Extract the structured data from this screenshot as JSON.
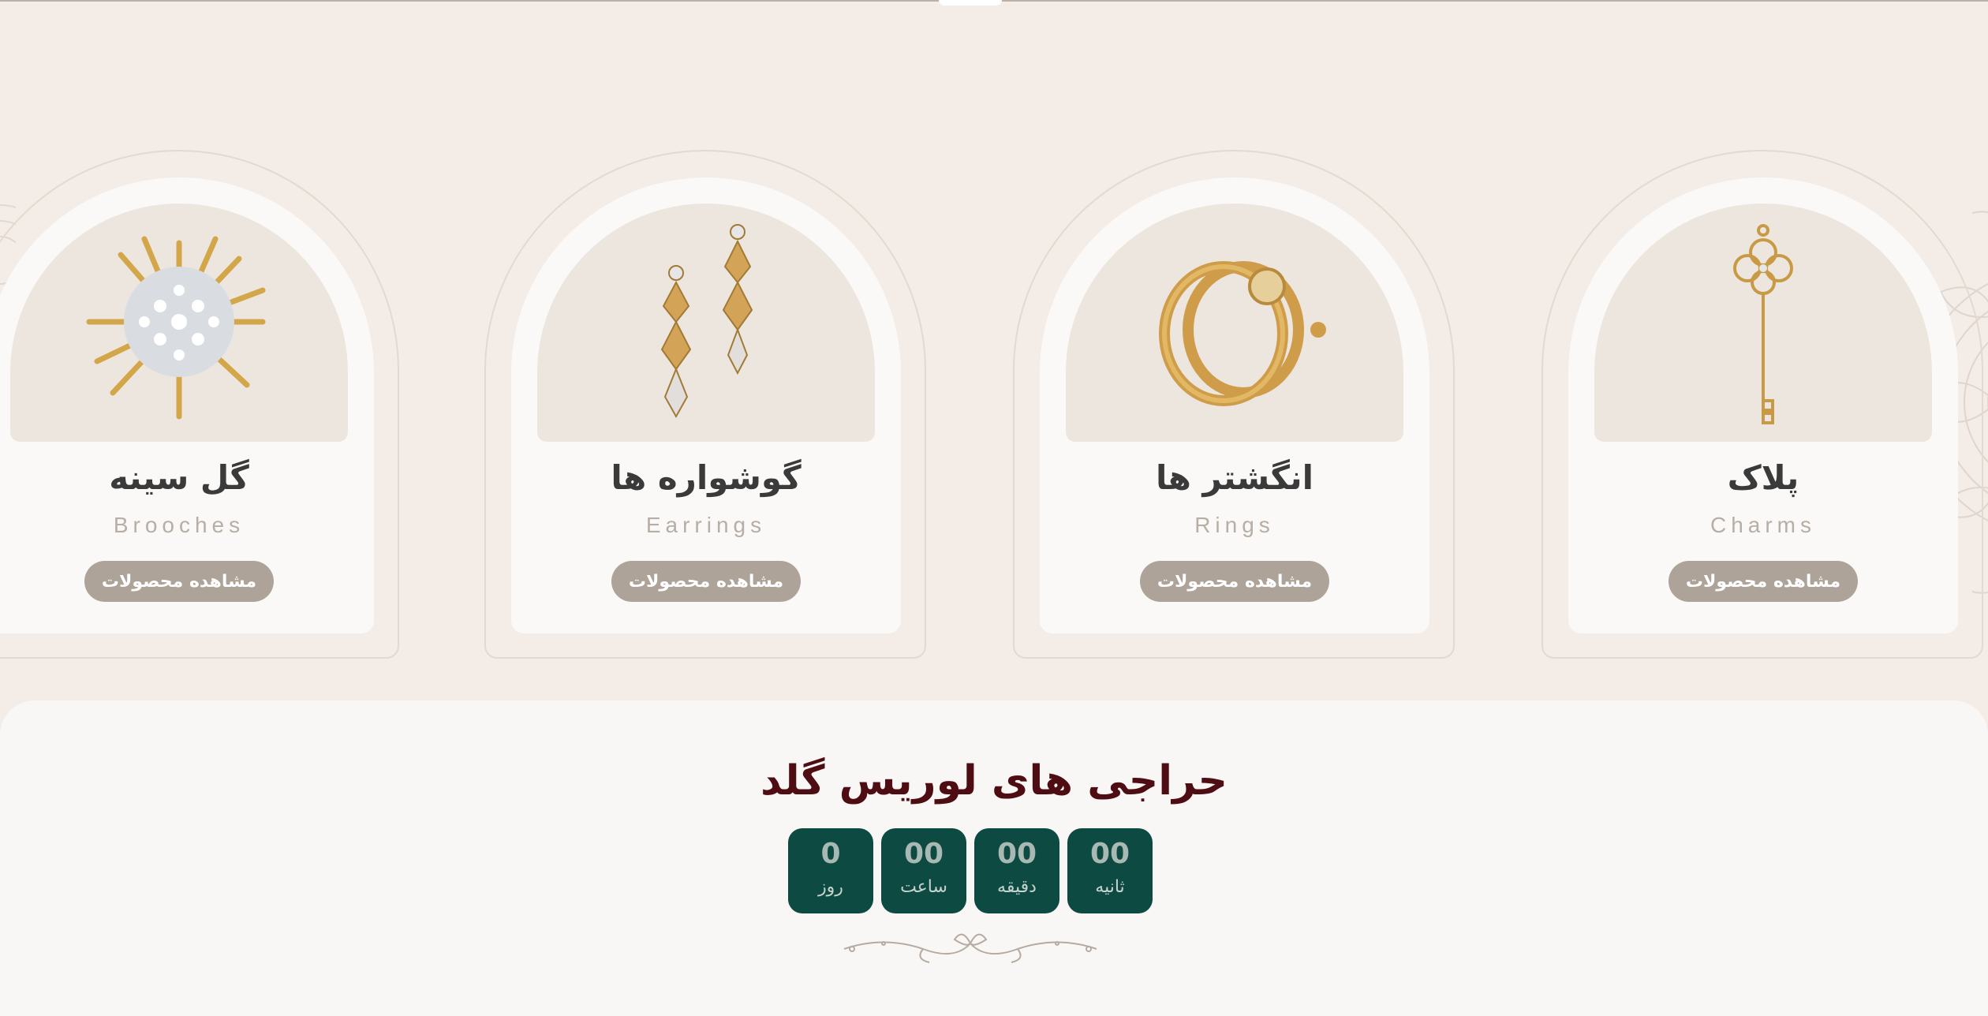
{
  "categories": [
    {
      "title": "گل سینه",
      "subtitle": "Brooches",
      "button": "مشاهده محصولات",
      "icon": "brooch-image"
    },
    {
      "title": "گوشواره ها",
      "subtitle": "Earrings",
      "button": "مشاهده محصولات",
      "icon": "earrings-image"
    },
    {
      "title": "انگشتر ها",
      "subtitle": "Rings",
      "button": "مشاهده محصولات",
      "icon": "ring-image"
    },
    {
      "title": "پلاک",
      "subtitle": "Charms",
      "button": "مشاهده محصولات",
      "icon": "key-charm-image"
    }
  ],
  "sale": {
    "title": "حراجی های لوریس گلد",
    "timer": [
      {
        "value": "0",
        "label": "روز"
      },
      {
        "value": "00",
        "label": "ساعت"
      },
      {
        "value": "00",
        "label": "دقیقه"
      },
      {
        "value": "00",
        "label": "ثانیه"
      }
    ]
  },
  "colors": {
    "background": "#f4ece6",
    "card": "#fbf9f7",
    "image_bg": "#ece6de",
    "button": "#aea398",
    "sale_title": "#4e0d12",
    "timer_box": "#0c4a42"
  }
}
